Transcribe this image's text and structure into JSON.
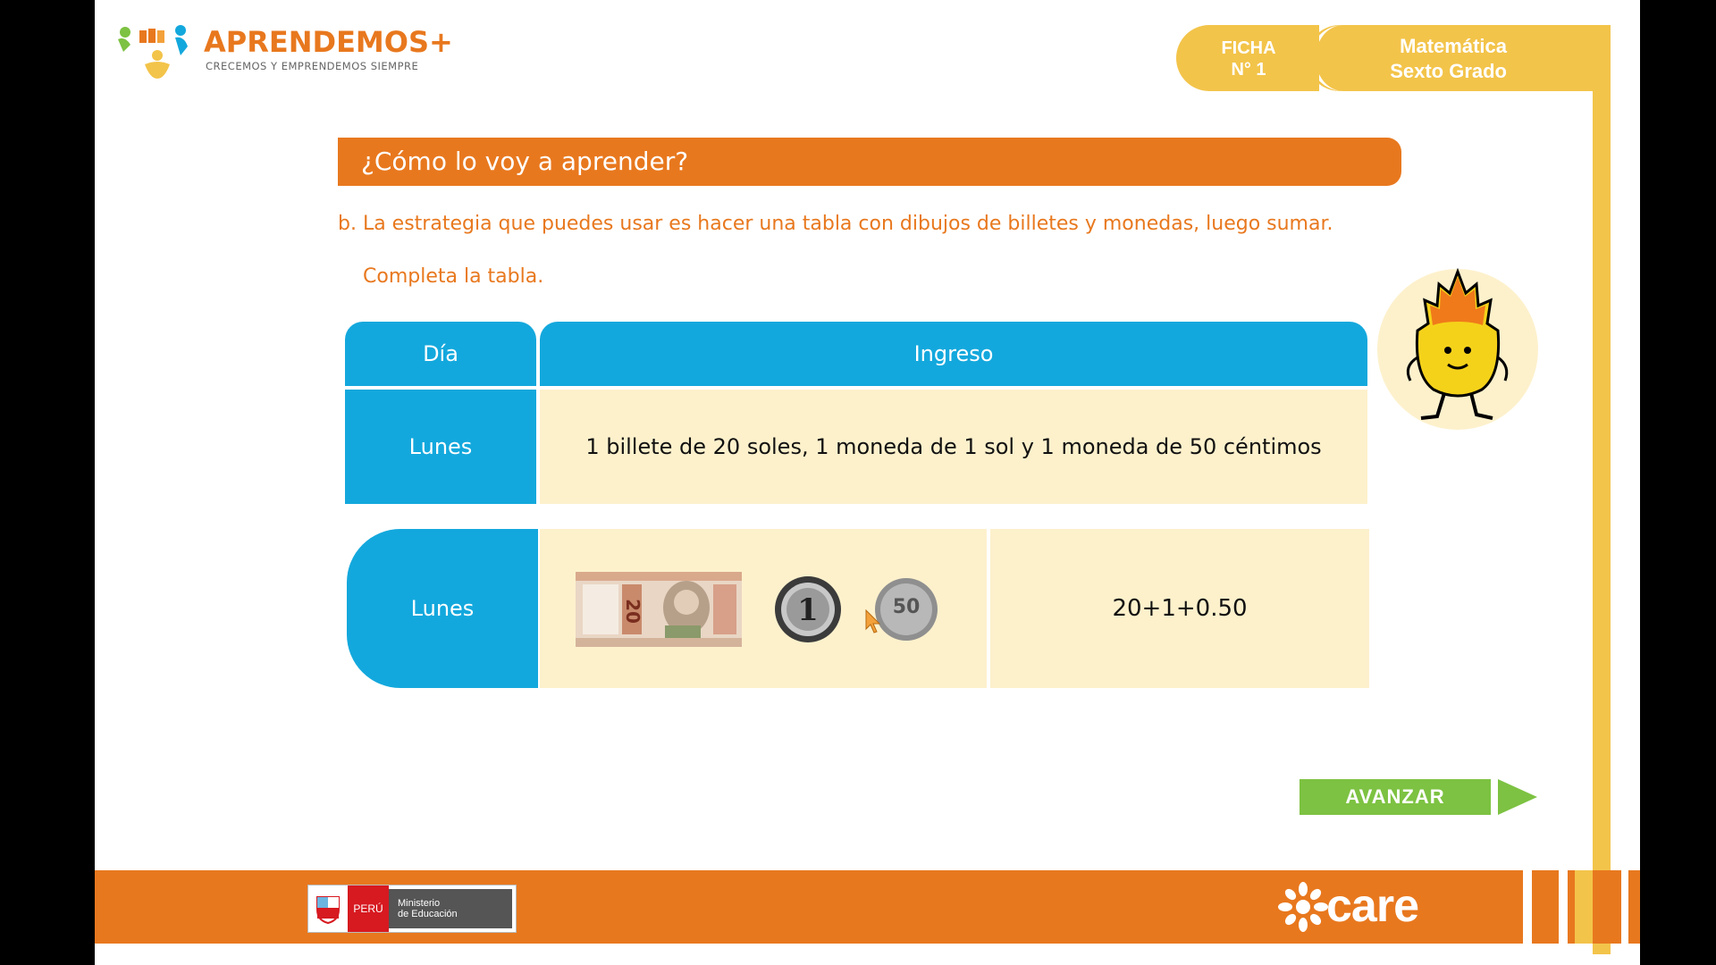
{
  "header": {
    "logo_title": "APRENDEMOS+",
    "logo_subtitle": "CRECEMOS Y EMPRENDEMOS SIEMPRE",
    "ficha_line1": "FICHA",
    "ficha_line2": "N° 1",
    "subject": "Matemática",
    "grade": "Sexto Grado"
  },
  "main": {
    "heading": "¿Cómo lo voy a aprender?",
    "instruction": "b. La estrategia que puedes usar es hacer una tabla con dibujos de billetes y monedas, luego sumar.",
    "complete_prompt": "Completa la tabla."
  },
  "table1": {
    "col_day": "Día",
    "col_income": "Ingreso",
    "row_day": "Lunes",
    "row_income": "1 billete de 20 soles, 1 moneda de 1 sol y 1 moneda de 50 céntimos"
  },
  "table2": {
    "row_day": "Lunes",
    "sum": "20+1+0.50",
    "bill_label": "20",
    "coin1_label": "1",
    "coin50_label": "50"
  },
  "nav": {
    "advance_label": "AVANZAR"
  },
  "footer": {
    "peru_label": "PERÚ",
    "ministry_line1": "Ministerio",
    "ministry_line2": "de Educación",
    "care_label": "care"
  },
  "colors": {
    "orange": "#e8781e",
    "blue": "#13a8dd",
    "cream": "#fdf1cc",
    "yellow": "#f3c44a",
    "green": "#7dc242"
  }
}
